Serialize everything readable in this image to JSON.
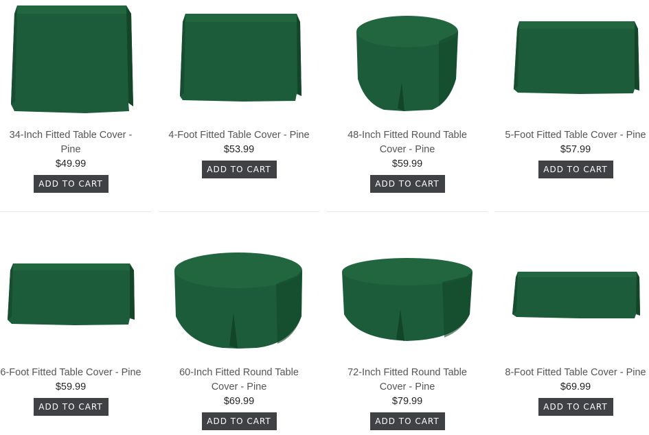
{
  "colors": {
    "fabric": "#1d5c3a",
    "fabric_dark": "#134629",
    "fabric_light": "#2a6e49",
    "button_bg": "#3f4144"
  },
  "products": [
    {
      "title": "34-Inch Fitted Table Cover - Pine",
      "price": "$49.99",
      "button": "ADD TO CART",
      "shape": "rect-tall"
    },
    {
      "title": "4-Foot Fitted Table Cover - Pine",
      "price": "$53.99",
      "button": "ADD TO CART",
      "shape": "rect"
    },
    {
      "title": "48-Inch Fitted Round Table Cover - Pine",
      "price": "$59.99",
      "button": "ADD TO CART",
      "shape": "round-small"
    },
    {
      "title": "5-Foot Fitted Table Cover - Pine",
      "price": "$57.99",
      "button": "ADD TO CART",
      "shape": "rect"
    },
    {
      "title": "6-Foot Fitted Table Cover - Pine",
      "price": "$59.99",
      "button": "ADD TO CART",
      "shape": "rect-wide"
    },
    {
      "title": "60-Inch Fitted Round Table Cover - Pine",
      "price": "$69.99",
      "button": "ADD TO CART",
      "shape": "round"
    },
    {
      "title": "72-Inch Fitted Round Table Cover - Pine",
      "price": "$79.99",
      "button": "ADD TO CART",
      "shape": "round-large"
    },
    {
      "title": "8-Foot Fitted Table Cover - Pine",
      "price": "$69.99",
      "button": "ADD TO CART",
      "shape": "rect-long"
    }
  ]
}
